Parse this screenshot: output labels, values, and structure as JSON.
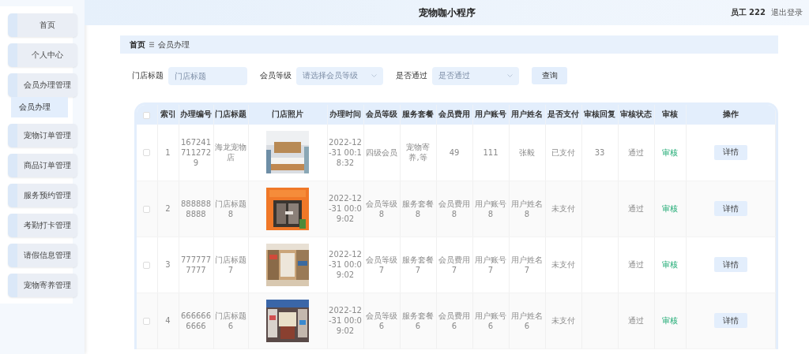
{
  "header": {
    "title": "宠物咖小程序",
    "user": "员工 222",
    "logout": "退出登录"
  },
  "sidebar": {
    "items": [
      {
        "label": "首页"
      },
      {
        "label": "个人中心"
      },
      {
        "label": "会员办理管理",
        "children": [
          {
            "label": "会员办理",
            "selected": true
          }
        ]
      },
      {
        "label": "宠物订单管理"
      },
      {
        "label": "商品订单管理"
      },
      {
        "label": "服务预约管理"
      },
      {
        "label": "考勤打卡管理"
      },
      {
        "label": "请假信息管理"
      },
      {
        "label": "宠物寄养管理"
      }
    ]
  },
  "breadcrumb": [
    "首页",
    "会员办理"
  ],
  "filters": [
    {
      "kind": "input",
      "label": "门店标题",
      "placeholder": "门店标题"
    },
    {
      "kind": "select",
      "label": "会员等级",
      "placeholder": "请选择会员等级"
    },
    {
      "kind": "select",
      "label": "是否通过",
      "placeholder": "是否通过"
    }
  ],
  "search_button": "查询",
  "table": {
    "all_checked": false,
    "columns": [
      "索引",
      "办理编号",
      "门店标题",
      "门店照片",
      "办理时间",
      "会员等级",
      "服务套餐",
      "会员费用",
      "用户账号",
      "用户姓名",
      "是否支付",
      "审核回复",
      "审核状态",
      "审核",
      "操作"
    ],
    "rows": [
      {
        "checked": false,
        "index": "1",
        "number": "1672417112729",
        "store": "海龙宠物店",
        "time": "2022-12-31 00:18:32",
        "level": "四级会员",
        "package": "宠物寄养,等",
        "fee": "49",
        "account": "111",
        "name": "张毅",
        "paid": "已支付",
        "reply": "33",
        "status": "通过",
        "review": "审核",
        "action": "详情"
      },
      {
        "checked": false,
        "index": "2",
        "number": "8888888888",
        "store": "门店标题8",
        "time": "2022-12-31 00:09:02",
        "level": "会员等级8",
        "package": "服务套餐8",
        "fee": "会员费用8",
        "account": "用户账号8",
        "name": "用户姓名8",
        "paid": "未支付",
        "status": "通过",
        "review": "审核",
        "action": "详情"
      },
      {
        "checked": false,
        "index": "3",
        "number": "7777777777",
        "store": "门店标题7",
        "time": "2022-12-31 00:09:02",
        "level": "会员等级7",
        "package": "服务套餐7",
        "fee": "会员费用7",
        "account": "用户账号7",
        "name": "用户姓名7",
        "paid": "未支付",
        "status": "通过",
        "review": "审核",
        "action": "详情"
      },
      {
        "checked": false,
        "index": "4",
        "number": "6666666666",
        "store": "门店标题6",
        "time": "2022-12-31 00:09:02",
        "level": "会员等级6",
        "package": "服务套餐6",
        "fee": "会员费用6",
        "account": "用户账号6",
        "name": "用户姓名6",
        "paid": "未支付",
        "status": "通过",
        "review": "审核",
        "action": "详情"
      }
    ]
  }
}
